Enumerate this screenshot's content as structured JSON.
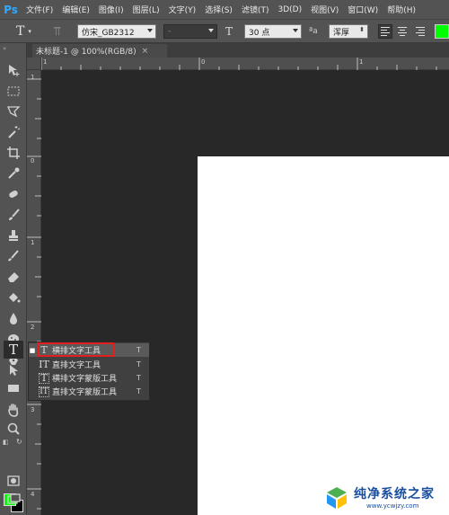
{
  "app": {
    "logo": "Ps"
  },
  "menu": [
    "文件(F)",
    "编辑(E)",
    "图像(I)",
    "图层(L)",
    "文字(Y)",
    "选择(S)",
    "滤镜(T)",
    "3D(D)",
    "视图(V)",
    "窗口(W)",
    "帮助(H)"
  ],
  "options": {
    "tool_glyph": "T",
    "font_family": "仿宋_GB2312",
    "font_style": "-",
    "size_glyph": "T",
    "font_size": "30 点",
    "aa_glyph": "ªa",
    "antialias": "浑厚",
    "text_color": "#00ff00"
  },
  "document": {
    "tab_title": "未标题-1 @ 100%(RGB/8)",
    "close": "×"
  },
  "ruler": {
    "h_labels": [
      "1",
      "0",
      "1"
    ],
    "v_labels": [
      "1",
      "0",
      "1",
      "2",
      "3",
      "4"
    ]
  },
  "flyout": [
    {
      "icon": "T",
      "label": "横排文字工具",
      "shortcut": "T",
      "selected": true
    },
    {
      "icon": "IT",
      "label": "直排文字工具",
      "shortcut": "T",
      "selected": false
    },
    {
      "icon": "T",
      "label": "横排文字蒙版工具",
      "shortcut": "T",
      "selected": false
    },
    {
      "icon": "IT",
      "label": "直排文字蒙版工具",
      "shortcut": "T",
      "selected": false
    }
  ],
  "colors": {
    "foreground": "#00ff00",
    "background": "#000000",
    "highlight": "#e0201e"
  },
  "watermark": {
    "title": "纯净系统之家",
    "url": "www.ycwjzy.com"
  }
}
